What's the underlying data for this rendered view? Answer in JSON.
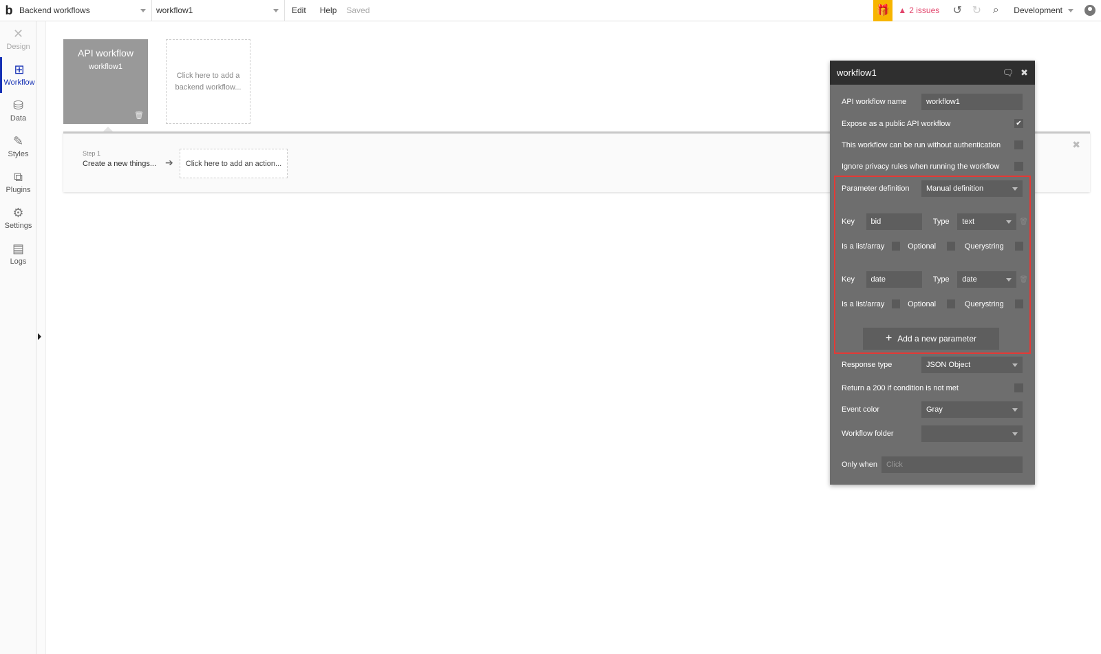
{
  "topbar": {
    "logo": "b",
    "page_select": "Backend workflows",
    "workflow_select": "workflow1",
    "menu": [
      "Edit",
      "Help"
    ],
    "save_status": "Saved",
    "issues": "2 issues",
    "environment": "Development"
  },
  "sidebar": {
    "items": [
      {
        "label": "Design",
        "icon": "design-icon",
        "glyph": "✕"
      },
      {
        "label": "Workflow",
        "icon": "workflow-icon",
        "glyph": "⊞"
      },
      {
        "label": "Data",
        "icon": "database-icon",
        "glyph": "⛁"
      },
      {
        "label": "Styles",
        "icon": "brush-icon",
        "glyph": "✎"
      },
      {
        "label": "Plugins",
        "icon": "plugin-icon",
        "glyph": "⧉"
      },
      {
        "label": "Settings",
        "icon": "gear-icon",
        "glyph": "⚙"
      },
      {
        "label": "Logs",
        "icon": "document-icon",
        "glyph": "▤"
      }
    ]
  },
  "canvas": {
    "event_card": {
      "title": "API workflow",
      "subtitle": "workflow1"
    },
    "add_backend": "Click here to add a backend workflow...",
    "step1": {
      "label": "Step 1",
      "text": "Create a new things..."
    },
    "add_action": "Click here to add an action..."
  },
  "panel": {
    "title": "workflow1",
    "api_name_label": "API workflow name",
    "api_name_value": "workflow1",
    "expose_label": "Expose as a public API workflow",
    "expose_checked": true,
    "no_auth_label": "This workflow can be run without authentication",
    "ignore_privacy_label": "Ignore privacy rules when running the workflow",
    "param_def_label": "Parameter definition",
    "param_def_value": "Manual definition",
    "params": [
      {
        "key_label": "Key",
        "key": "bid",
        "type_label": "Type",
        "type": "text",
        "list_label": "Is a list/array",
        "optional_label": "Optional",
        "query_label": "Querystring"
      },
      {
        "key_label": "Key",
        "key": "date",
        "type_label": "Type",
        "type": "date",
        "list_label": "Is a list/array",
        "optional_label": "Optional",
        "query_label": "Querystring"
      }
    ],
    "add_param": "Add a new parameter",
    "response_type_label": "Response type",
    "response_type_value": "JSON Object",
    "return200_label": "Return a 200 if condition is not met",
    "event_color_label": "Event color",
    "event_color_value": "Gray",
    "folder_label": "Workflow folder",
    "folder_value": "",
    "only_when_label": "Only when",
    "only_when_placeholder": "Click"
  },
  "colors": {
    "accent": "#1530b4",
    "issues": "#e2456c",
    "gift": "#f7b500",
    "highlight_box": "#e53935",
    "panel_bg": "#6e6e6e"
  }
}
